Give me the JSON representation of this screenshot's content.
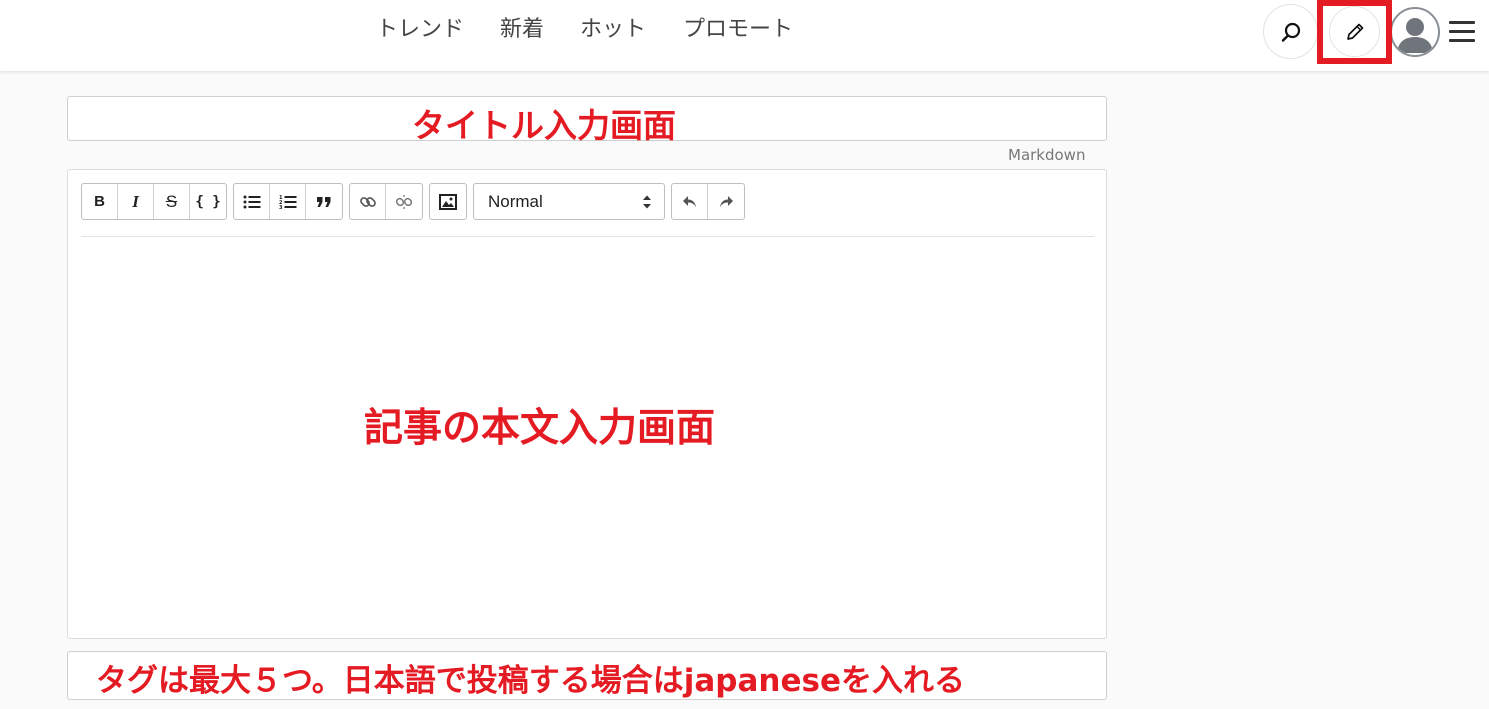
{
  "nav": {
    "links": [
      "トレンド",
      "新着",
      "ホット",
      "プロモート"
    ]
  },
  "header_icons": {
    "search": "search-icon",
    "write": "pencil-icon",
    "avatar": "user-avatar-icon",
    "menu": "hamburger-menu-icon"
  },
  "annotations": {
    "title": "タイトル入力画面",
    "body": "記事の本文入力画面",
    "tags": "タグは最大５つ。日本語で投稿する場合はjapaneseを入れる"
  },
  "editor": {
    "mode_link": "Markdown",
    "format_select": "Normal",
    "toolbar": {
      "bold": "B",
      "italic": "I",
      "strike": "S",
      "code": "{ }"
    }
  },
  "colors": {
    "annotation_red": "#e51b24",
    "background": "#fafafa"
  }
}
